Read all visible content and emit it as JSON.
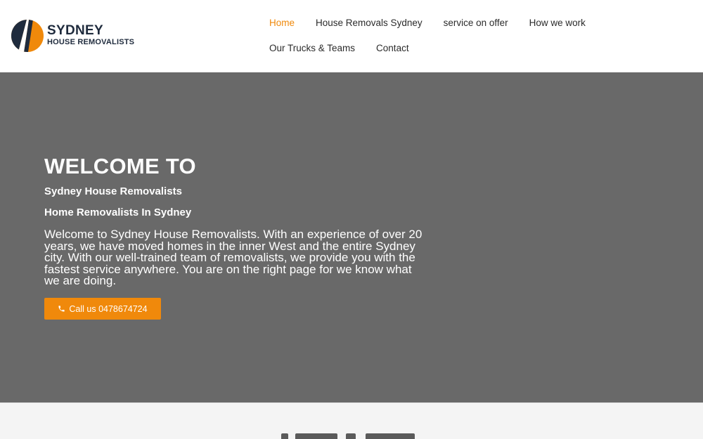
{
  "brand": {
    "name_line1": "SYDNEY",
    "name_line2": "HOUSE REMOVALISTS",
    "colors": {
      "navy": "#1f2b3d",
      "orange": "#f0890b"
    }
  },
  "nav": {
    "items": [
      {
        "label": "Home",
        "active": true
      },
      {
        "label": "House Removals Sydney",
        "active": false
      },
      {
        "label": "service on offer",
        "active": false
      },
      {
        "label": "How we work",
        "active": false
      },
      {
        "label": "Our Trucks & Teams",
        "active": false
      },
      {
        "label": "Contact",
        "active": false
      }
    ]
  },
  "hero": {
    "title": "WELCOME TO",
    "subtitle1": "Sydney House Removalists",
    "subtitle2": "Home Removalists In Sydney",
    "body": "Welcome to Sydney House Removalists. With an experience of over 20 years, we have moved homes in the inner West and the entire Sydney city. With our well-trained team of removalists, we provide you with the fastest service anywhere. You are on the right page for we know what we are doing.",
    "cta_label": "Call us 0478674724",
    "cta_icon": "phone-icon",
    "background_color": "#696969"
  }
}
